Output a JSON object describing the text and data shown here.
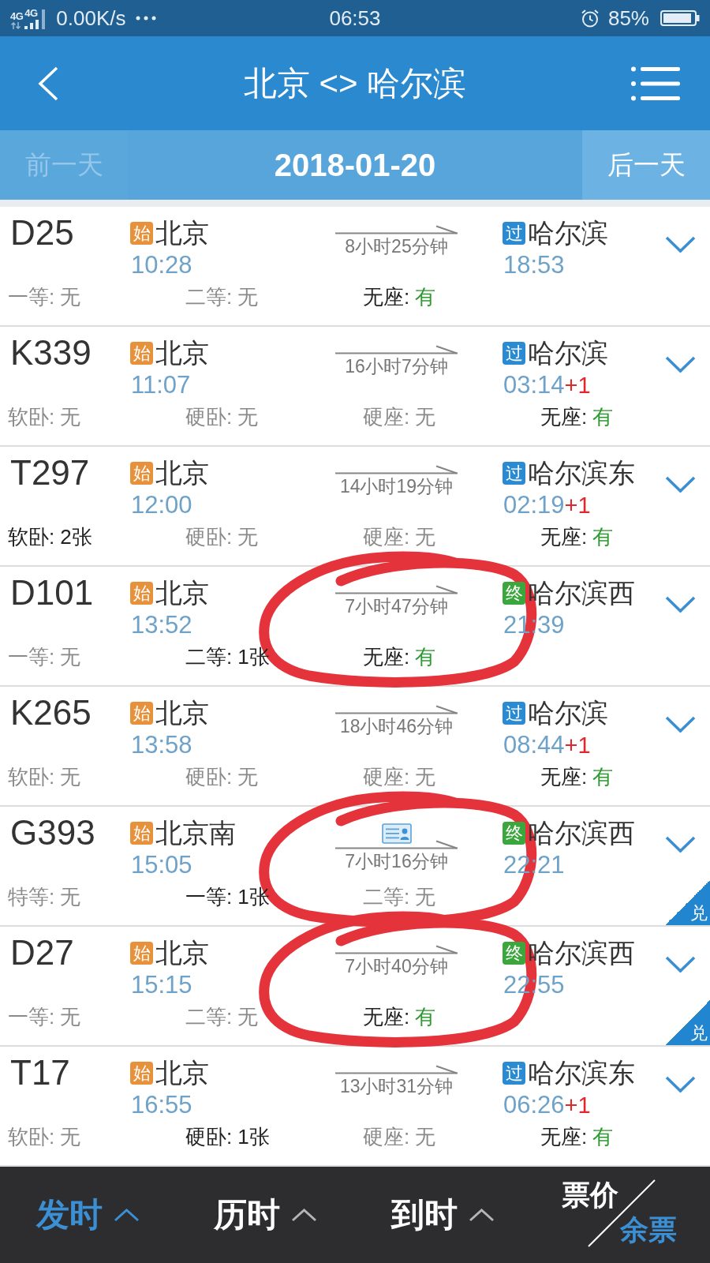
{
  "status_bar": {
    "network": [
      "4G",
      "4G"
    ],
    "speed": "0.00K/s",
    "time": "06:53",
    "battery": "85%"
  },
  "header": {
    "title": "北京 <> 哈尔滨"
  },
  "date_bar": {
    "previous": {
      "label": "前一天",
      "disabled": true
    },
    "date": "2018-01-20",
    "next": {
      "label": "后一天",
      "disabled": false
    }
  },
  "rows": [
    {
      "train": "D25",
      "departure": {
        "tag": "始",
        "color": "#e8913b",
        "station": "北京",
        "time": "10:28"
      },
      "duration": "8小时25分钟",
      "id_card": false,
      "arrival": {
        "tag": "过",
        "color": "#2a8ad2",
        "station": "哈尔滨",
        "time": "18:53"
      },
      "seats": [
        {
          "label": "一等:",
          "value": "无",
          "kind": "none"
        },
        {
          "label": "二等:",
          "value": "无",
          "kind": "none"
        },
        {
          "label": "无座:",
          "value": "有",
          "kind": "plenty"
        }
      ],
      "circled": false
    },
    {
      "train": "K339",
      "departure": {
        "tag": "始",
        "color": "#e8913b",
        "station": "北京",
        "time": "11:07"
      },
      "duration": "16小时7分钟",
      "id_card": false,
      "arrival": {
        "tag": "过",
        "color": "#2a8ad2",
        "station": "哈尔滨",
        "time": "03:14",
        "next_day": "+1"
      },
      "seats": [
        {
          "label": "软卧:",
          "value": "无",
          "kind": "none"
        },
        {
          "label": "硬卧:",
          "value": "无",
          "kind": "none"
        },
        {
          "label": "硬座:",
          "value": "无",
          "kind": "none"
        },
        {
          "label": "无座:",
          "value": "有",
          "kind": "plenty"
        }
      ],
      "circled": false
    },
    {
      "train": "T297",
      "departure": {
        "tag": "始",
        "color": "#e8913b",
        "station": "北京",
        "time": "12:00"
      },
      "duration": "14小时19分钟",
      "id_card": false,
      "arrival": {
        "tag": "过",
        "color": "#2a8ad2",
        "station": "哈尔滨东",
        "time": "02:19",
        "next_day": "+1"
      },
      "seats": [
        {
          "label": "软卧:",
          "value": "2张",
          "kind": "count"
        },
        {
          "label": "硬卧:",
          "value": "无",
          "kind": "none"
        },
        {
          "label": "硬座:",
          "value": "无",
          "kind": "none"
        },
        {
          "label": "无座:",
          "value": "有",
          "kind": "plenty"
        }
      ],
      "circled": false
    },
    {
      "train": "D101",
      "departure": {
        "tag": "始",
        "color": "#e8913b",
        "station": "北京",
        "time": "13:52"
      },
      "duration": "7小时47分钟",
      "id_card": false,
      "arrival": {
        "tag": "终",
        "color": "#3aa63c",
        "station": "哈尔滨西",
        "time": "21:39"
      },
      "seats": [
        {
          "label": "一等:",
          "value": "无",
          "kind": "none"
        },
        {
          "label": "二等:",
          "value": "1张",
          "kind": "count"
        },
        {
          "label": "无座:",
          "value": "有",
          "kind": "plenty"
        }
      ],
      "circled": true
    },
    {
      "train": "K265",
      "departure": {
        "tag": "始",
        "color": "#e8913b",
        "station": "北京",
        "time": "13:58"
      },
      "duration": "18小时46分钟",
      "id_card": false,
      "arrival": {
        "tag": "过",
        "color": "#2a8ad2",
        "station": "哈尔滨",
        "time": "08:44",
        "next_day": "+1"
      },
      "seats": [
        {
          "label": "软卧:",
          "value": "无",
          "kind": "none"
        },
        {
          "label": "硬卧:",
          "value": "无",
          "kind": "none"
        },
        {
          "label": "硬座:",
          "value": "无",
          "kind": "none"
        },
        {
          "label": "无座:",
          "value": "有",
          "kind": "plenty"
        }
      ],
      "circled": false
    },
    {
      "train": "G393",
      "departure": {
        "tag": "始",
        "color": "#e8913b",
        "station": "北京南",
        "time": "15:05"
      },
      "duration": "7小时16分钟",
      "id_card": true,
      "arrival": {
        "tag": "终",
        "color": "#3aa63c",
        "station": "哈尔滨西",
        "time": "22:21"
      },
      "seats": [
        {
          "label": "特等:",
          "value": "无",
          "kind": "none"
        },
        {
          "label": "一等:",
          "value": "1张",
          "kind": "count"
        },
        {
          "label": "二等:",
          "value": "无",
          "kind": "none"
        }
      ],
      "corner_tag": "兑",
      "circled": true
    },
    {
      "train": "D27",
      "departure": {
        "tag": "始",
        "color": "#e8913b",
        "station": "北京",
        "time": "15:15"
      },
      "duration": "7小时40分钟",
      "id_card": false,
      "arrival": {
        "tag": "终",
        "color": "#3aa63c",
        "station": "哈尔滨西",
        "time": "22:55"
      },
      "seats": [
        {
          "label": "一等:",
          "value": "无",
          "kind": "none"
        },
        {
          "label": "二等:",
          "value": "无",
          "kind": "none"
        },
        {
          "label": "无座:",
          "value": "有",
          "kind": "plenty"
        }
      ],
      "corner_tag": "兑",
      "circled": true
    },
    {
      "train": "T17",
      "departure": {
        "tag": "始",
        "color": "#e8913b",
        "station": "北京",
        "time": "16:55"
      },
      "duration": "13小时31分钟",
      "id_card": false,
      "arrival": {
        "tag": "过",
        "color": "#2a8ad2",
        "station": "哈尔滨东",
        "time": "06:26",
        "next_day": "+1"
      },
      "seats": [
        {
          "label": "软卧:",
          "value": "无",
          "kind": "none"
        },
        {
          "label": "硬卧:",
          "value": "1张",
          "kind": "count"
        },
        {
          "label": "硬座:",
          "value": "无",
          "kind": "none"
        },
        {
          "label": "无座:",
          "value": "有",
          "kind": "plenty"
        }
      ],
      "circled": false
    }
  ],
  "sort_bar": {
    "tabs": [
      {
        "label": "发时",
        "selected": true
      },
      {
        "label": "历时",
        "selected": false
      },
      {
        "label": "到时",
        "selected": false
      }
    ],
    "display_toggle": [
      {
        "label": "票价",
        "selected": false
      },
      {
        "label": "余票",
        "selected": true
      }
    ]
  }
}
